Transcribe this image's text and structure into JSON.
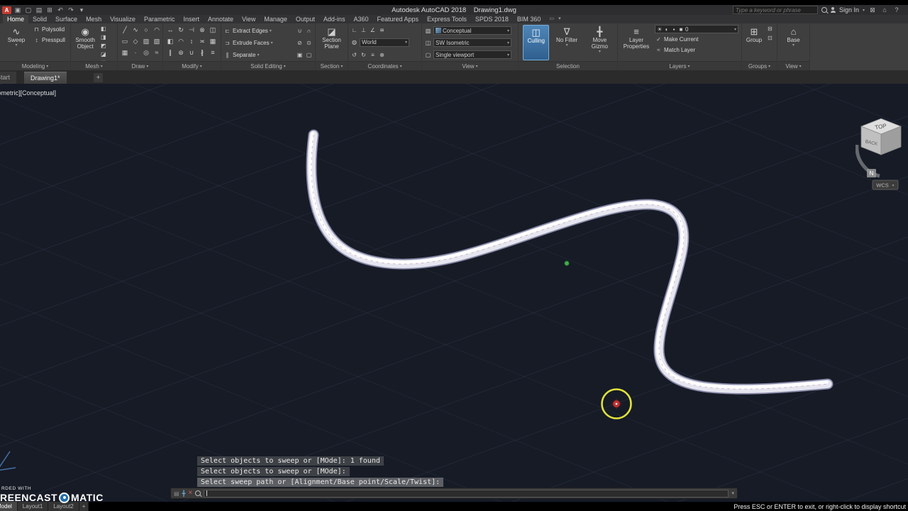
{
  "titlebar": {
    "app_label": "A",
    "title": "Autodesk AutoCAD 2018    Drawing1.dwg",
    "search_placeholder": "Type a keyword or phrase",
    "sign_in": "Sign In"
  },
  "ribbon": {
    "tabs": [
      "Home",
      "Solid",
      "Surface",
      "Mesh",
      "Visualize",
      "Parametric",
      "Insert",
      "Annotate",
      "View",
      "Manage",
      "Output",
      "Add-ins",
      "A360",
      "Featured Apps",
      "Express Tools",
      "SPDS 2018",
      "BIM 360"
    ],
    "panels": {
      "modeling": {
        "label": "Modeling",
        "sweep": "Sweep",
        "polysolid": "Polysolid",
        "presspull": "Presspull"
      },
      "mesh": {
        "label": "Mesh",
        "smooth_object": "Smooth Object"
      },
      "draw": {
        "label": "Draw"
      },
      "modify": {
        "label": "Modify"
      },
      "solid_editing": {
        "label": "Solid Editing",
        "extract_edges": "Extract Edges",
        "extrude_faces": "Extrude Faces",
        "separate": "Separate"
      },
      "section": {
        "label": "Section",
        "section_plane": "Section Plane"
      },
      "coordinates": {
        "label": "Coordinates",
        "world": "World"
      },
      "view": {
        "label": "View",
        "visual_style": "Conceptual",
        "view_preset": "SW Isometric",
        "viewport_config": "Single viewport"
      },
      "selection": {
        "label": "Selection",
        "culling": "Culling",
        "no_filter": "No Filter",
        "move_gizmo": "Move Gizmo"
      },
      "layers": {
        "label": "Layers",
        "layer_properties": "Layer Properties",
        "current_layer": "0",
        "make_current": "Make Current",
        "match_layer": "Match Layer"
      },
      "groups": {
        "label": "Groups",
        "group": "Group"
      },
      "view_extra": {
        "label": "View",
        "base": "Base"
      }
    }
  },
  "file_tabs": {
    "start": "Start",
    "drawing": "Drawing1*",
    "new_tab": "+"
  },
  "viewport": {
    "controls": "[-][SW Isometric][Conceptual]",
    "viewcube": {
      "top": "TOP",
      "back": "BACK",
      "north": "N",
      "wcs": "WCS"
    }
  },
  "command": {
    "history": [
      "Select objects to sweep or [MOde]: 1 found",
      "Select objects to sweep or [MOde]:",
      "Select sweep path or [Alignment/Base point/Scale/Twist]:"
    ]
  },
  "statusbar": {
    "hint": "Press ESC or ENTER to exit, or right-click to display shortcut",
    "model_tab": "Model",
    "layout1_tab": "Layout1",
    "layout2_tab": "Layout2",
    "add_layout": "+"
  },
  "watermark": {
    "recorded_with": "RDED WITH",
    "brand_left": "REENCAST",
    "brand_right": "MATIC"
  },
  "colors": {
    "canvas_bg": "#161b26",
    "selection_blue": "#4e86b8",
    "cursor_highlight": "#e2e23c",
    "tube": "#e9e9f2"
  },
  "icons": {
    "dd_arrow": "▾",
    "qat": [
      "▣",
      "▢",
      "▤",
      "⊞",
      "↶",
      "↷",
      "▾"
    ],
    "titlebar_right": [
      "⊠",
      "⌂",
      "?"
    ],
    "tab_extras": [
      "▭",
      "▾"
    ],
    "modeling": {
      "sweep": "∿",
      "polysolid": "⊓",
      "presspull": "↕"
    },
    "mesh": {
      "smooth": "◉",
      "tools": [
        "◧",
        "◨",
        "◩",
        "◪",
        "▤",
        "▥"
      ]
    },
    "draw": [
      "╱",
      "∿",
      "○",
      "◠",
      "▭",
      "◇",
      "▨",
      "▧",
      "▦",
      "·",
      "◎",
      "≈"
    ],
    "modify": [
      "↔",
      "↻",
      "⊣",
      "⊗",
      "◫",
      "◧",
      "◠",
      "↕",
      "≍",
      "▦",
      "∥",
      "⊛",
      "∪",
      "∦",
      "≡"
    ],
    "solid": {
      "extract": "⊏",
      "extrude": "⊐",
      "separate": "∥",
      "extras": [
        "∪",
        "∩",
        "⊘",
        "⊙",
        "▣",
        "▢"
      ]
    },
    "section": {
      "plane": "◪"
    },
    "coordinates": {
      "row1": [
        "∟",
        "⊥",
        "∠",
        "≅"
      ],
      "world": "◍",
      "row3": [
        "↺",
        "↻",
        "≡",
        "⊕"
      ]
    },
    "view": {
      "rows": [
        "▧",
        "◫",
        "▢"
      ]
    },
    "selection": {
      "culling": "◫",
      "no_filter": "∇",
      "move_gizmo": "╋"
    },
    "layers": {
      "properties": "≡",
      "state": [
        "☀",
        "◐",
        "▪",
        "■"
      ],
      "make_current": "✓",
      "match_layer": "≈"
    },
    "groups": {
      "group": "⊞",
      "tools": [
        "⊟",
        "⊡"
      ]
    },
    "view_extra": {
      "base": "⌂"
    },
    "cmdbar": {
      "grip": "▤",
      "close": "×",
      "customize": "╋",
      "chevron": "▾"
    }
  }
}
